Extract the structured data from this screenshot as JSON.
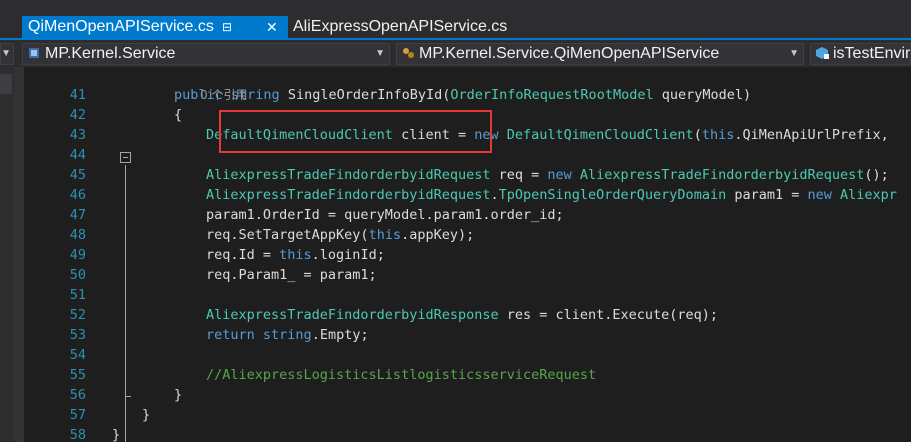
{
  "tabs": {
    "active": {
      "label": "QiMenOpenAPIService.cs",
      "pin_icon": "pin-icon",
      "close_icon": "close-icon"
    },
    "inactive": {
      "label": "AliExpressOpenAPIService.cs"
    }
  },
  "navbar": {
    "project": "MP.Kernel.Service",
    "class": "MP.Kernel.Service.QiMenOpenAPIService",
    "member": "isTestEnvir"
  },
  "code": {
    "ref_hint": "0 个引用",
    "lines": [
      {
        "num": "41",
        "parts": [
          [
            "kw",
            "public"
          ],
          [
            "pl",
            " "
          ],
          [
            "kw",
            "string"
          ],
          [
            "pl",
            " SingleOrderInfoById("
          ],
          [
            "ty",
            "OrderInfoRequestRootModel"
          ],
          [
            "pl",
            " queryModel)"
          ]
        ],
        "indent": 0
      },
      {
        "num": "42",
        "parts": [
          [
            "pl",
            "{"
          ]
        ],
        "indent": 0
      },
      {
        "num": "43",
        "parts": [
          [
            "ty",
            "DefaultQimenCloudClient"
          ],
          [
            "pl",
            " client = "
          ],
          [
            "kw",
            "new"
          ],
          [
            "pl",
            " "
          ],
          [
            "ty",
            "DefaultQimenCloudClient"
          ],
          [
            "pl",
            "("
          ],
          [
            "kw",
            "this"
          ],
          [
            "pl",
            ".QiMenApiUrlPrefix,"
          ]
        ],
        "indent": 1
      },
      {
        "num": "44",
        "parts": [],
        "indent": 1
      },
      {
        "num": "45",
        "parts": [
          [
            "ty",
            "AliexpressTradeFindorderbyidRequest"
          ],
          [
            "pl",
            " req = "
          ],
          [
            "kw",
            "new"
          ],
          [
            "pl",
            " "
          ],
          [
            "ty",
            "AliexpressTradeFindorderbyidRequest"
          ],
          [
            "pl",
            "();"
          ]
        ],
        "indent": 1
      },
      {
        "num": "46",
        "parts": [
          [
            "ty",
            "AliexpressTradeFindorderbyidRequest"
          ],
          [
            "pl",
            "."
          ],
          [
            "ty",
            "TpOpenSingleOrderQueryDomain"
          ],
          [
            "pl",
            " param1 = "
          ],
          [
            "kw",
            "new"
          ],
          [
            "pl",
            " "
          ],
          [
            "ty",
            "Aliexpr"
          ]
        ],
        "indent": 1
      },
      {
        "num": "47",
        "parts": [
          [
            "pl",
            "param1.OrderId = queryModel.param1.order_id;"
          ]
        ],
        "indent": 1
      },
      {
        "num": "48",
        "parts": [
          [
            "pl",
            "req.SetTargetAppKey("
          ],
          [
            "kw",
            "this"
          ],
          [
            "pl",
            ".appKey);"
          ]
        ],
        "indent": 1
      },
      {
        "num": "49",
        "parts": [
          [
            "pl",
            "req.Id = "
          ],
          [
            "kw",
            "this"
          ],
          [
            "pl",
            ".loginId;"
          ]
        ],
        "indent": 1
      },
      {
        "num": "50",
        "parts": [
          [
            "pl",
            "req.Param1_ = param1;"
          ]
        ],
        "indent": 1
      },
      {
        "num": "51",
        "parts": [],
        "indent": 1
      },
      {
        "num": "52",
        "parts": [
          [
            "ty",
            "AliexpressTradeFindorderbyidResponse"
          ],
          [
            "pl",
            " res = client.Execute(req);"
          ]
        ],
        "indent": 1
      },
      {
        "num": "53",
        "parts": [
          [
            "kw",
            "return"
          ],
          [
            "pl",
            " "
          ],
          [
            "kw",
            "string"
          ],
          [
            "pl",
            ".Empty;"
          ]
        ],
        "indent": 1
      },
      {
        "num": "54",
        "parts": [],
        "indent": 1
      },
      {
        "num": "55",
        "parts": [
          [
            "cm",
            "//AliexpressLogisticsListlogisticsserviceRequest"
          ]
        ],
        "indent": 1
      },
      {
        "num": "56",
        "parts": [
          [
            "pl",
            "}"
          ]
        ],
        "indent": 0
      },
      {
        "num": "57",
        "parts": [
          [
            "pl",
            "}"
          ]
        ],
        "indent": -1
      },
      {
        "num": "58",
        "parts": [
          [
            "pl",
            "}"
          ]
        ],
        "indent": -2
      }
    ]
  },
  "colors": {
    "keyword": "#569cd6",
    "type": "#4ec9b0",
    "comment": "#57a64a",
    "line_number": "#2b91af",
    "highlight": "#e53935",
    "tab_accent": "#007acc"
  }
}
